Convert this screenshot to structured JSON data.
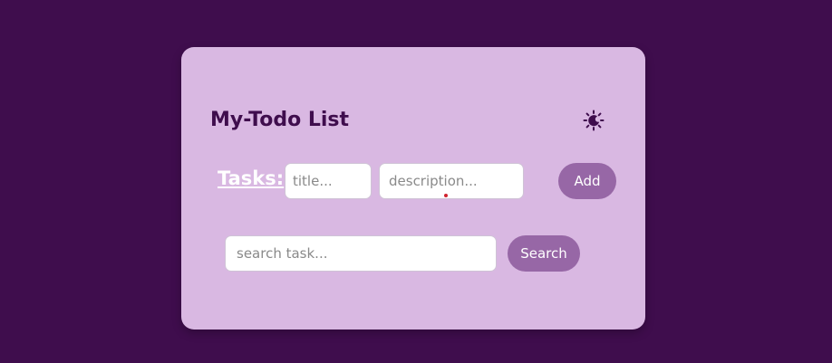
{
  "app": {
    "title": "My-Todo List"
  },
  "header": {
    "theme_toggle_icon": "sun-moon-icon"
  },
  "task_form": {
    "label": "Tasks:",
    "title_placeholder": "title...",
    "title_value": "",
    "description_placeholder": "description...",
    "description_value": "",
    "add_label": "Add"
  },
  "search": {
    "placeholder": "search task...",
    "value": "",
    "button_label": "Search"
  },
  "colors": {
    "page_background": "#3f0d4d",
    "card_background": "#d9b8e2",
    "accent": "#9767a6",
    "title_text": "#3f0d4d"
  }
}
